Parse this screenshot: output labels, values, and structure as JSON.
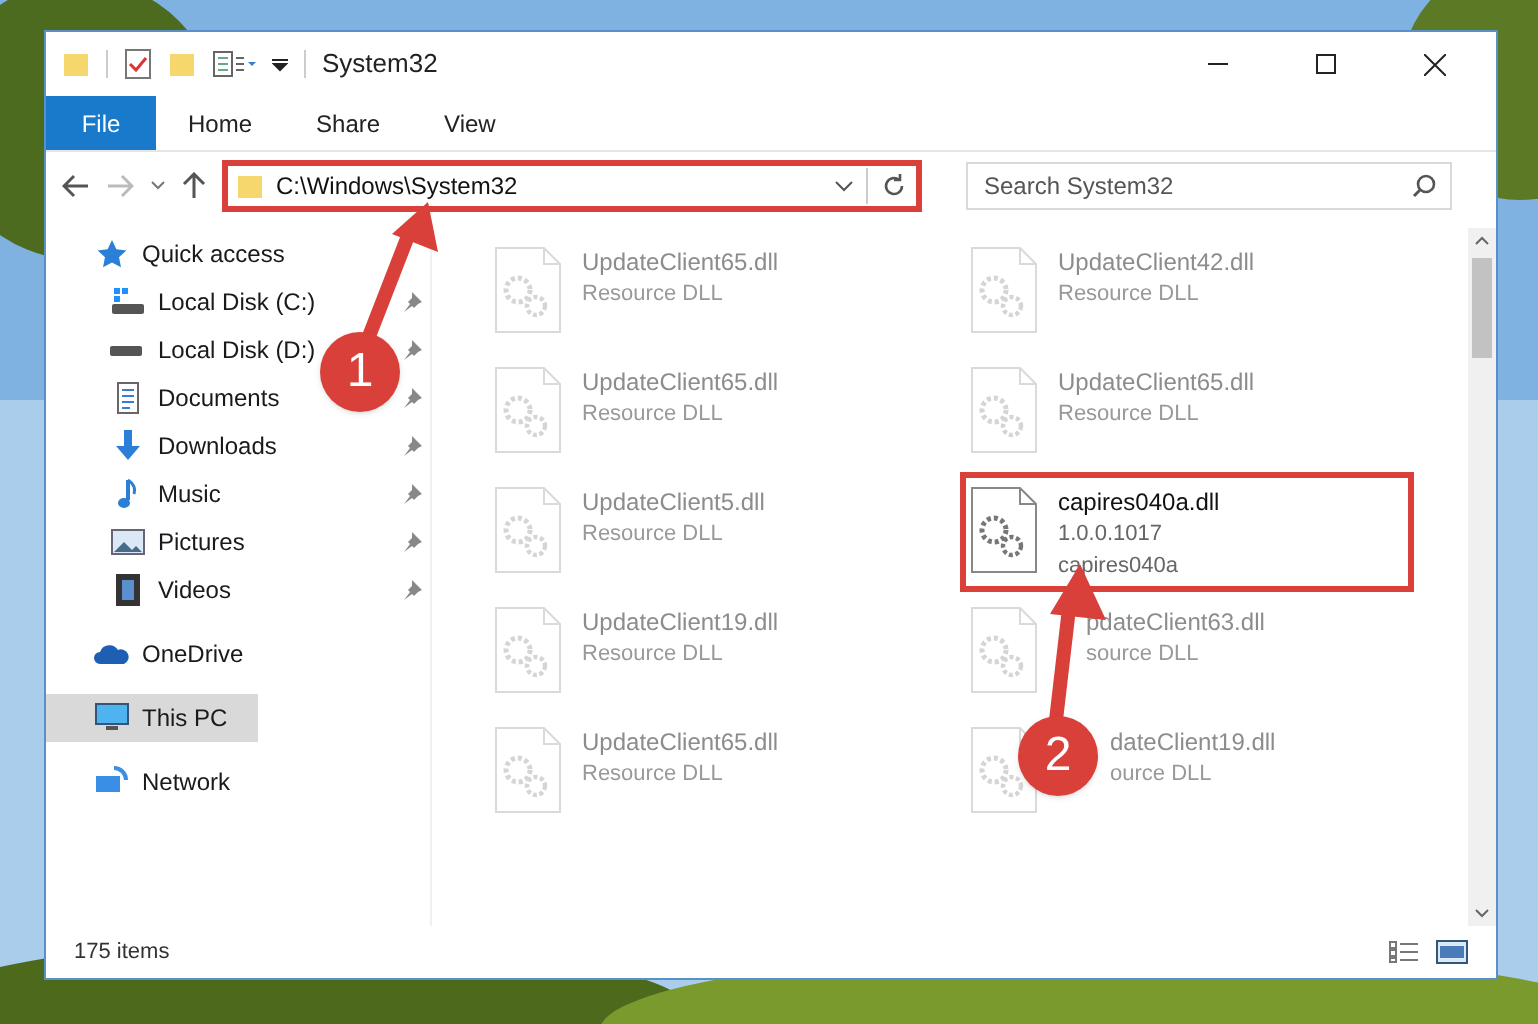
{
  "window": {
    "title": "System32"
  },
  "ribbon_tabs": [
    {
      "label": "File",
      "kind": "file"
    },
    {
      "label": "Home",
      "kind": "tab"
    },
    {
      "label": "Share",
      "kind": "tab"
    },
    {
      "label": "View",
      "kind": "tab"
    }
  ],
  "address": {
    "path": "C:\\Windows\\System32",
    "highlighted": true
  },
  "search": {
    "placeholder": "Search System32"
  },
  "sidebar": {
    "items": [
      {
        "label": "Quick access",
        "kind": "star",
        "selected": false,
        "children": [
          {
            "label": "Local Disk (C:)",
            "kind": "drive-c",
            "pinned": true
          },
          {
            "label": "Local Disk (D:)",
            "kind": "drive",
            "pinned": true
          },
          {
            "label": "Documents",
            "kind": "documents",
            "pinned": true
          },
          {
            "label": "Downloads",
            "kind": "downloads",
            "pinned": true
          },
          {
            "label": "Music",
            "kind": "music",
            "pinned": true
          },
          {
            "label": "Pictures",
            "kind": "pictures",
            "pinned": true
          },
          {
            "label": "Videos",
            "kind": "videos",
            "pinned": true
          }
        ]
      },
      {
        "label": "OneDrive",
        "kind": "cloud",
        "selected": false
      },
      {
        "label": "This PC",
        "kind": "pc",
        "selected": true
      },
      {
        "label": "Network",
        "kind": "network",
        "selected": false
      }
    ]
  },
  "files": [
    {
      "lines": [
        "UpdateClient65.dll",
        "Resource DLL"
      ],
      "blurred": true,
      "highlighted": false
    },
    {
      "lines": [
        "UpdateClient42.dll",
        "Resource DLL"
      ],
      "blurred": true,
      "highlighted": false
    },
    {
      "lines": [
        "UpdateClient65.dll",
        "Resource DLL"
      ],
      "blurred": true,
      "highlighted": false
    },
    {
      "lines": [
        "UpdateClient65.dll",
        "Resource DLL"
      ],
      "blurred": true,
      "highlighted": false
    },
    {
      "lines": [
        "UpdateClient5.dll",
        "Resource DLL"
      ],
      "blurred": true,
      "highlighted": false
    },
    {
      "lines": [
        "capires040a.dll",
        "1.0.0.1017",
        "capires040a"
      ],
      "blurred": false,
      "highlighted": true
    },
    {
      "lines": [
        "UpdateClient19.dll",
        "Resource DLL"
      ],
      "blurred": true,
      "highlighted": false
    },
    {
      "lines": [
        "pdateClient63.dll",
        "source DLL"
      ],
      "blurred": true,
      "highlighted": false,
      "kind": "covered"
    },
    {
      "lines": [
        "UpdateClient65.dll",
        "Resource DLL"
      ],
      "blurred": true,
      "highlighted": false
    },
    {
      "lines": [
        "dateClient19.dll",
        "ource DLL"
      ],
      "blurred": true,
      "highlighted": false,
      "kind": "badge-covered"
    }
  ],
  "callouts": [
    {
      "number": "1"
    },
    {
      "number": "2"
    }
  ],
  "status_bar": {
    "count": "175 items"
  }
}
